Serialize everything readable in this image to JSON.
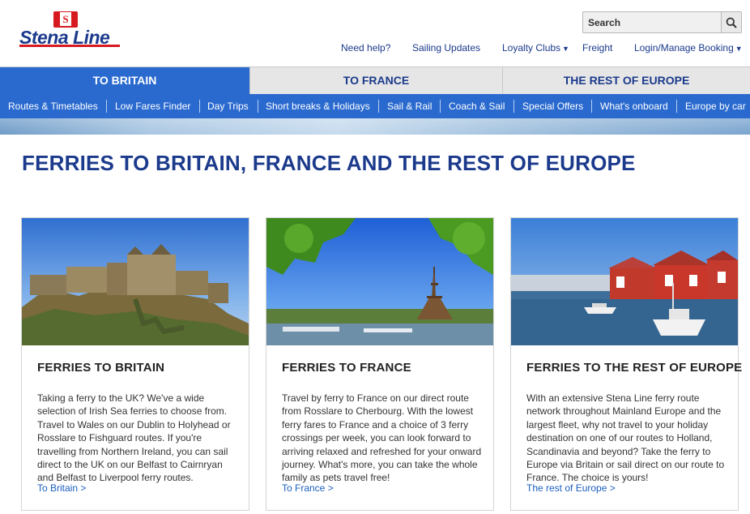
{
  "brand": {
    "name": "Stena Line",
    "flag_letter": "S",
    "primary_color": "#1b3a8c",
    "accent_color": "#d71920",
    "nav_color": "#2a6acf"
  },
  "search": {
    "placeholder": "Search",
    "icon": "search-icon"
  },
  "utility_nav": {
    "need_help": "Need help?",
    "sailing_updates": "Sailing Updates",
    "loyalty_clubs": "Loyalty Clubs",
    "freight": "Freight",
    "login": "Login/Manage Booking",
    "caret": "▼"
  },
  "tabs": [
    {
      "label": "TO BRITAIN",
      "active": true
    },
    {
      "label": "TO FRANCE",
      "active": false
    },
    {
      "label": "THE REST OF EUROPE",
      "active": false
    }
  ],
  "subnav": [
    "Routes & Timetables",
    "Low Fares Finder",
    "Day Trips",
    "Short breaks & Holidays",
    "Sail & Rail",
    "Coach & Sail",
    "Special Offers",
    "What's onboard",
    "Europe by car"
  ],
  "page_title": "FERRIES TO BRITAIN, FRANCE AND THE REST OF EUROPE",
  "cards": [
    {
      "title": "FERRIES TO BRITAIN",
      "body": "Taking a ferry to the UK? We've a wide selection of Irish Sea ferries to choose from. Travel to Wales on our Dublin to Holyhead or Rosslare to Fishguard routes. If you're travelling from Northern Ireland, you can sail direct to the UK on our Belfast to Cairnryan and Belfast to Liverpool ferry routes.",
      "link": "To Britain >"
    },
    {
      "title": "FERRIES TO FRANCE",
      "body": "Travel by ferry to France on our direct route from Rosslare to Cherbourg. With the lowest ferry fares to France and a choice of 3 ferry crossings per week, you can look forward to arriving relaxed and refreshed for your onward journey. What's more, you can take the whole family as pets travel free!",
      "link": "To France >"
    },
    {
      "title": "FERRIES TO THE REST OF EUROPE",
      "body": "With an extensive Stena Line ferry route network throughout Mainland Europe and the largest fleet, why not travel to your holiday destination on one of our routes to Holland, Scandinavia and beyond? Take the ferry to Europe via Britain or sail direct on our route to France. The choice is yours!",
      "link": "The rest of Europe >"
    }
  ]
}
